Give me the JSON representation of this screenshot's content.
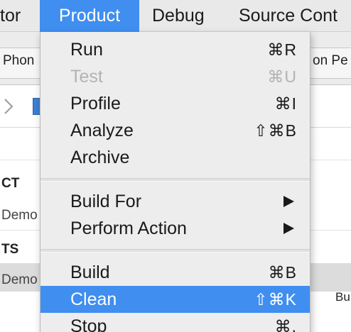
{
  "menubar": {
    "items": [
      {
        "label": "tor",
        "active": false
      },
      {
        "label": "Product",
        "active": true
      },
      {
        "label": "Debug",
        "active": false
      },
      {
        "label": "Source Cont",
        "active": false
      }
    ]
  },
  "background": {
    "scheme_left": "Phon",
    "scheme_right": "on Pe",
    "section_ct": "CT",
    "row_demo_1": "Demo",
    "section_ts": "TS",
    "row_demo_2": "Demo",
    "right_text": "Bu"
  },
  "product_menu": {
    "items": [
      {
        "label": "Run",
        "shortcut": "⌘R",
        "enabled": true
      },
      {
        "label": "Test",
        "shortcut": "⌘U",
        "enabled": false
      },
      {
        "label": "Profile",
        "shortcut": "⌘I",
        "enabled": true
      },
      {
        "label": "Analyze",
        "shortcut": "⇧⌘B",
        "enabled": true
      },
      {
        "label": "Archive",
        "shortcut": "",
        "enabled": true
      },
      {
        "label": "Build For",
        "shortcut": "",
        "submenu": true
      },
      {
        "label": "Perform Action",
        "shortcut": "",
        "submenu": true
      },
      {
        "label": "Build",
        "shortcut": "⌘B",
        "enabled": true
      },
      {
        "label": "Clean",
        "shortcut": "⇧⌘K",
        "enabled": true,
        "highlighted": true
      },
      {
        "label": "Stop",
        "shortcut": "⌘.",
        "enabled": true
      }
    ]
  },
  "colors": {
    "menu_highlight": "#3f8ef0",
    "menu_background": "#ededed",
    "menubar_background": "#e9e9e9",
    "disabled_text": "#b3b3b3"
  }
}
